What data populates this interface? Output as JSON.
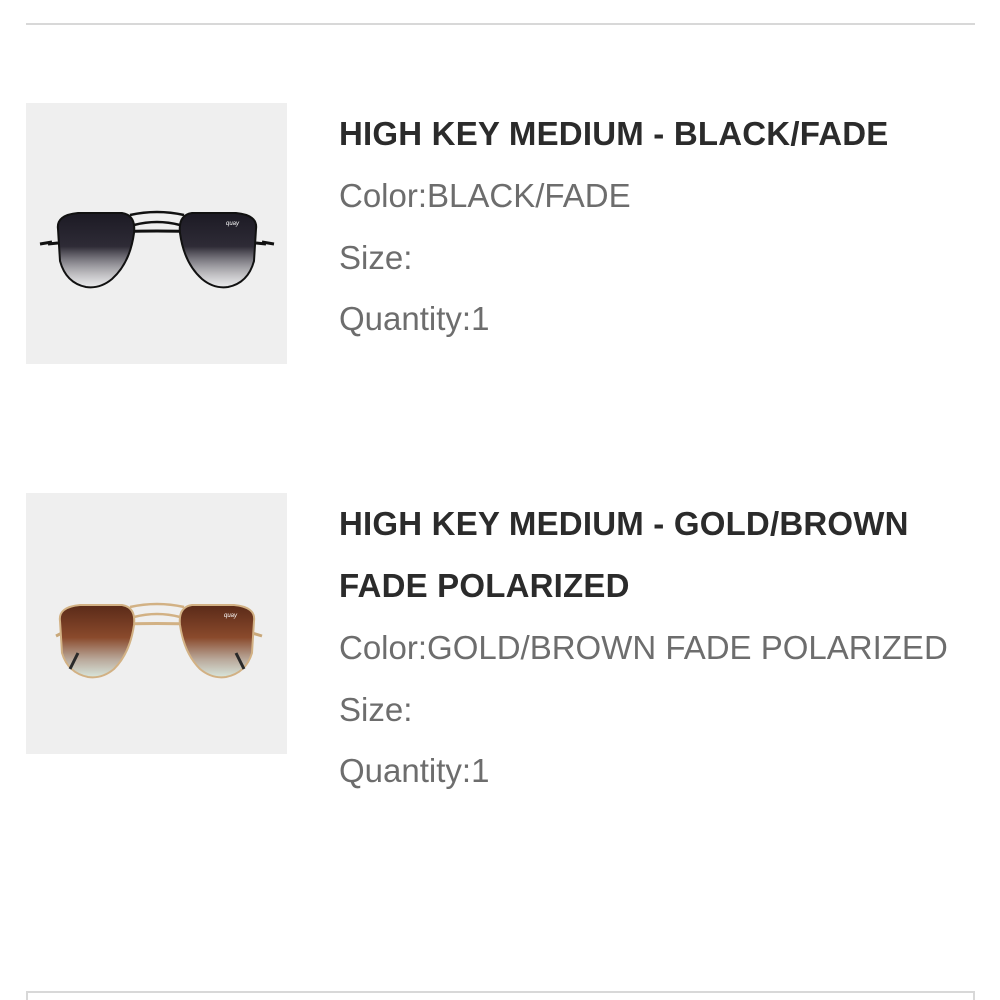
{
  "items": [
    {
      "title": "HIGH KEY MEDIUM - BLACK/FADE",
      "color_line": "Color:BLACK/FADE",
      "size_line": "Size:",
      "quantity_line": "Quantity:1",
      "image_icon": "black-fade-aviator-sunglasses"
    },
    {
      "title": "HIGH KEY MEDIUM - GOLD/BROWN FADE POLARIZED",
      "color_line": "Color:GOLD/BROWN FADE POLARIZED",
      "size_line": "Size:",
      "quantity_line": "Quantity:1",
      "image_icon": "gold-brown-fade-aviator-sunglasses"
    }
  ],
  "colors": {
    "title_text": "#2b2b2b",
    "attribute_text": "#6d6d6d",
    "thumbnail_background": "#efefef",
    "divider": "#d8d8d8"
  }
}
